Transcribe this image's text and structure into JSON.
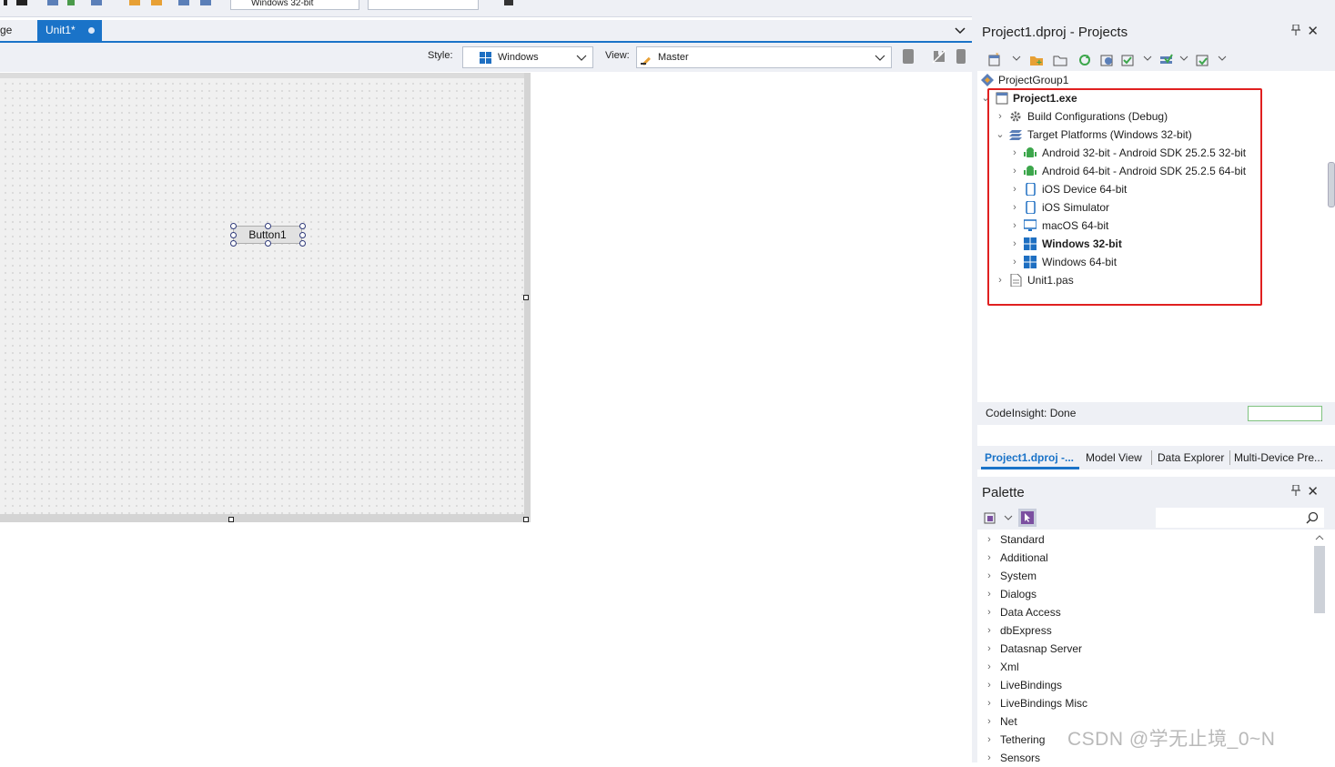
{
  "toolbar": {
    "platform_combo": "Windows 32-bit"
  },
  "doc_tabs": {
    "partial_tab": "ge",
    "active_tab": "Unit1*"
  },
  "form_toolbar": {
    "style_label": "Style:",
    "style_value": "Windows",
    "view_label": "View:",
    "view_value": "Master"
  },
  "designer": {
    "button_caption": "Button1"
  },
  "projects": {
    "title": "Project1.dproj - Projects",
    "pin": "📌",
    "close": "✕",
    "tree": {
      "group": "ProjectGroup1",
      "project": "Project1.exe",
      "build_configs": "Build Configurations (Debug)",
      "target_platforms": "Target Platforms (Windows 32-bit)",
      "platforms": [
        "Android 32-bit - Android SDK 25.2.5 32-bit",
        "Android 64-bit - Android SDK 25.2.5 64-bit",
        "iOS Device 64-bit",
        "iOS Simulator",
        "macOS 64-bit",
        "Windows 32-bit",
        "Windows 64-bit"
      ],
      "unit": "Unit1.pas"
    },
    "status": "CodeInsight: Done",
    "bottom_tabs": [
      "Project1.dproj -...",
      "Model View",
      "Data Explorer",
      "Multi-Device Pre..."
    ]
  },
  "palette": {
    "title": "Palette",
    "categories": [
      "Standard",
      "Additional",
      "System",
      "Dialogs",
      "Data Access",
      "dbExpress",
      "Datasnap Server",
      "Xml",
      "LiveBindings",
      "LiveBindings Misc",
      "Net",
      "Tethering",
      "Sensors"
    ]
  },
  "watermark": "CSDN @学无止境_0~N",
  "colors": {
    "accent": "#1a73c8",
    "highlight_box": "#e02020",
    "android": "#3ca64b",
    "windows": "#1e6fc2"
  }
}
